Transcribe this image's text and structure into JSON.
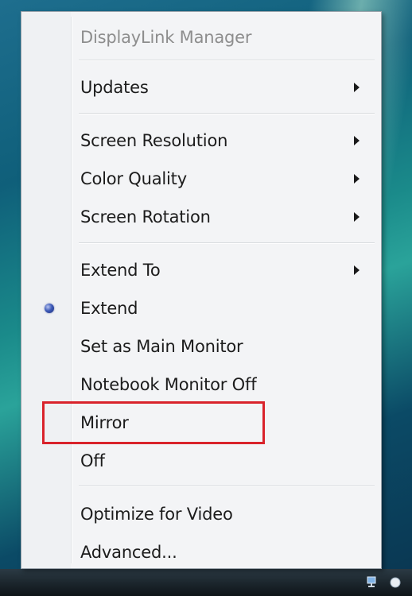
{
  "menu": {
    "header": "DisplayLink Manager",
    "groups": [
      {
        "items": [
          {
            "label": "Updates",
            "submenu": true
          }
        ]
      },
      {
        "items": [
          {
            "label": "Screen Resolution",
            "submenu": true
          },
          {
            "label": "Color Quality",
            "submenu": true
          },
          {
            "label": "Screen Rotation",
            "submenu": true
          }
        ]
      },
      {
        "items": [
          {
            "label": "Extend To",
            "submenu": true
          },
          {
            "label": "Extend",
            "selected": true
          },
          {
            "label": "Set as Main Monitor"
          },
          {
            "label": "Notebook Monitor Off"
          },
          {
            "label": "Mirror",
            "highlighted": true
          },
          {
            "label": "Off"
          }
        ]
      },
      {
        "items": [
          {
            "label": "Optimize for Video"
          },
          {
            "label": "Advanced..."
          }
        ]
      }
    ]
  },
  "colors": {
    "highlight_border": "#d9232b",
    "menu_background": "#f3f4f6",
    "radio_selected": "#3d5ab8"
  }
}
